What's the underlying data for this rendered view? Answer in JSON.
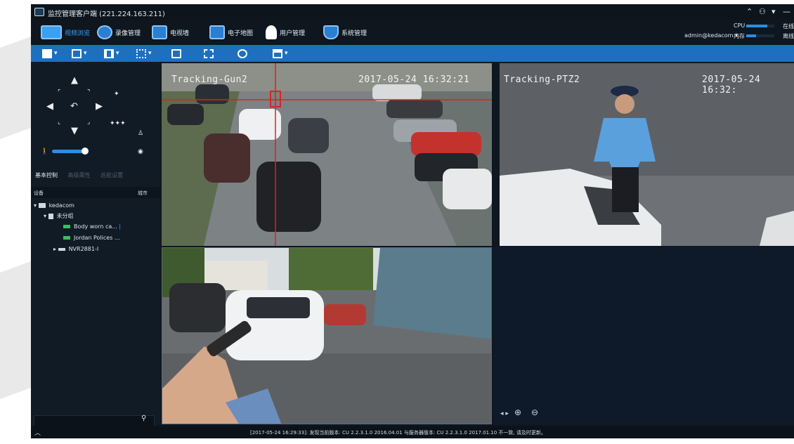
{
  "window": {
    "title": "监控管理客户端  (221.224.163.211)",
    "controls": [
      "⌃",
      "⚇",
      "▾",
      "—"
    ]
  },
  "nav": {
    "items": [
      {
        "label": "视频浏览",
        "active": true
      },
      {
        "label": "录像管理"
      },
      {
        "label": "电视墙"
      },
      {
        "label": "电子地图"
      },
      {
        "label": "用户管理"
      },
      {
        "label": "系统管理"
      }
    ],
    "user": "admin@kedacom",
    "cpu_label": "CPU",
    "mem_label": "内存",
    "cpu_level": 0.75,
    "mem_level": 0.35,
    "online_label": "在线",
    "offline_label": "离线"
  },
  "ptz": {
    "tabs": [
      "基本控制",
      "高级属性",
      "巡航设置"
    ]
  },
  "device_panel": {
    "header_left": "设备",
    "header_right": "城市",
    "tree": [
      {
        "label": "kedacom",
        "level": 0
      },
      {
        "label": "未分组",
        "level": 1
      },
      {
        "label": "Body worn ca...",
        "level": 2
      },
      {
        "label": "Jordan Polices ...",
        "level": 2
      },
      {
        "label": "NVR2881-I",
        "level": 1
      }
    ],
    "search_placeholder": ""
  },
  "videos": [
    {
      "osd_name": "Tracking-Gun2",
      "osd_time": "2017-05-24 16:32:21"
    },
    {
      "osd_name": "Tracking-PTZ2",
      "osd_time": "2017-05-24 16:32:"
    },
    {
      "osd_name": "",
      "osd_time": ""
    },
    {
      "osd_name": "",
      "osd_time": ""
    }
  ],
  "status": {
    "message": "[2017-05-24 16:29:33]: 发现当前版本: CU 2.2.3.1.0 2016.04.01 与服务器版本: CU 2.2.3.1.0 2017.01.10 不一致, 请及时更新。"
  },
  "colors": {
    "accent": "#1f6fbf",
    "active": "#39a0f5",
    "tracking": "#e02020"
  }
}
